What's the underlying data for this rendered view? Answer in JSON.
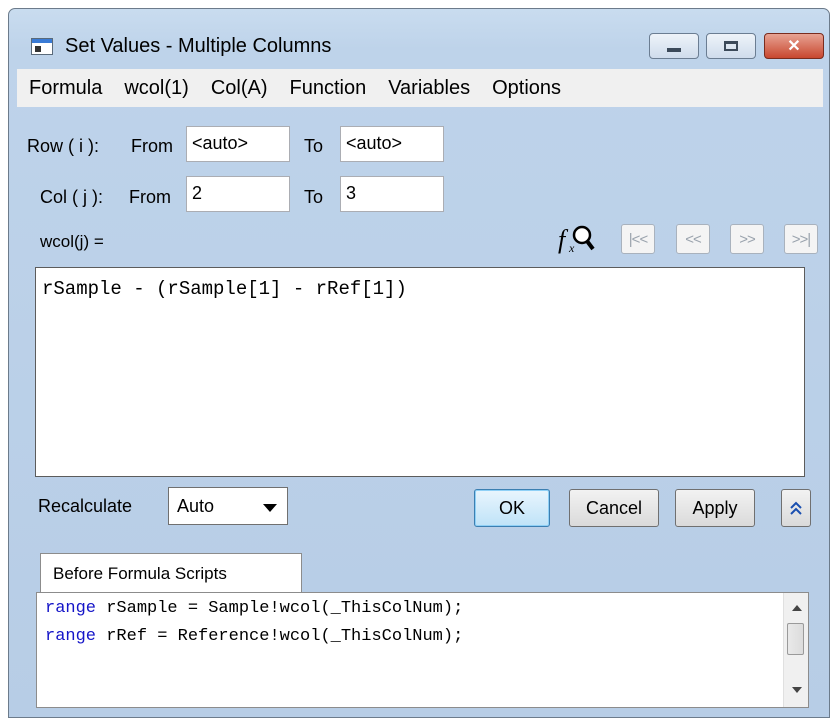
{
  "window": {
    "title": "Set Values - Multiple Columns"
  },
  "menu": [
    "Formula",
    "wcol(1)",
    "Col(A)",
    "Function",
    "Variables",
    "Options"
  ],
  "row_range": {
    "label": "Row ( i ):",
    "from_label": "From",
    "from_value": "<auto>",
    "to_label": "To",
    "to_value": "<auto>"
  },
  "col_range": {
    "label": "Col ( j ):",
    "from_label": "From",
    "from_value": "2",
    "to_label": "To",
    "to_value": "3"
  },
  "formula": {
    "label": "wcol(j) =",
    "expression": "rSample - (rSample[1] - rRef[1])",
    "nav_buttons": [
      "|<<",
      "<<",
      ">>",
      ">>|"
    ]
  },
  "recalculate": {
    "label": "Recalculate",
    "selected": "Auto"
  },
  "buttons": {
    "ok": "OK",
    "cancel": "Cancel",
    "apply": "Apply",
    "collapse": "»"
  },
  "scripts": {
    "tab_label": "Before Formula Scripts",
    "lines": [
      {
        "keyword": "range",
        "rest": " rSample = Sample!wcol(_ThisColNum);"
      },
      {
        "keyword": "range",
        "rest": " rRef = Reference!wcol(_ThisColNum);"
      }
    ]
  }
}
